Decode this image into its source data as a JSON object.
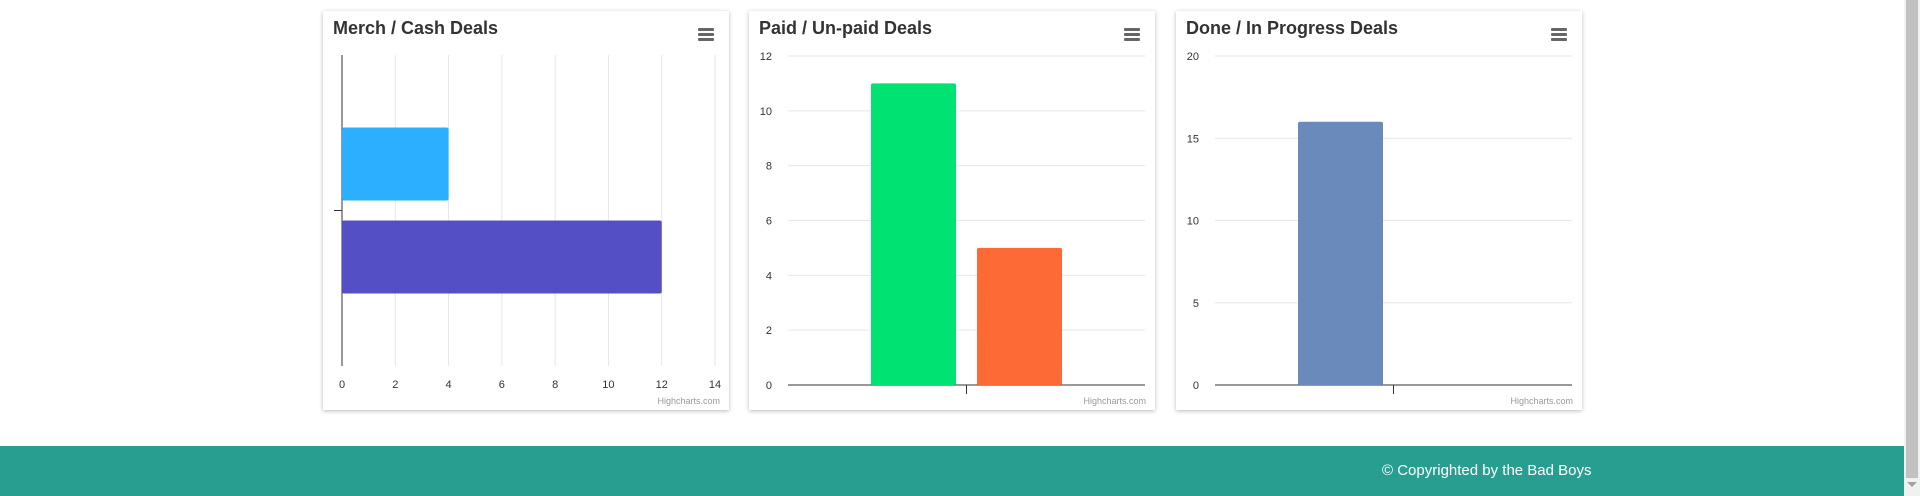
{
  "charts": [
    {
      "title": "Merch / Cash Deals",
      "menu_icon": "hamburger-menu-icon",
      "credit": "Highcharts.com",
      "chart_data": {
        "type": "bar",
        "orientation": "horizontal",
        "title": "Merch / Cash Deals",
        "xlabel": "",
        "ylabel": "",
        "categories": [
          ""
        ],
        "series": [
          {
            "values": [
              4
            ],
            "color": "#2caffe"
          },
          {
            "values": [
              12
            ],
            "color": "#544fc5"
          }
        ],
        "xlim": [
          0,
          14
        ],
        "ticks": [
          0,
          2,
          4,
          6,
          8,
          10,
          12,
          14
        ],
        "grid": true,
        "legend": "none"
      }
    },
    {
      "title": "Paid / Un-paid Deals",
      "menu_icon": "hamburger-menu-icon",
      "credit": "Highcharts.com",
      "chart_data": {
        "type": "bar",
        "orientation": "vertical",
        "title": "Paid / Un-paid Deals",
        "xlabel": "",
        "ylabel": "",
        "categories": [
          ""
        ],
        "series": [
          {
            "values": [
              11
            ],
            "color": "#00e272"
          },
          {
            "values": [
              5
            ],
            "color": "#fe6a35"
          }
        ],
        "ylim": [
          0,
          12
        ],
        "ticks": [
          0,
          2,
          4,
          6,
          8,
          10,
          12
        ],
        "grid": true,
        "legend": "none"
      }
    },
    {
      "title": "Done / In Progress Deals",
      "menu_icon": "hamburger-menu-icon",
      "credit": "Highcharts.com",
      "chart_data": {
        "type": "bar",
        "orientation": "vertical",
        "title": "Done / In Progress Deals",
        "xlabel": "",
        "ylabel": "",
        "categories": [
          ""
        ],
        "series": [
          {
            "values": [
              16
            ],
            "color": "#6b8abc"
          },
          {
            "values": [
              0
            ],
            "color": "#d568fb"
          }
        ],
        "ylim": [
          0,
          20
        ],
        "ticks": [
          0,
          5,
          10,
          15,
          20
        ],
        "grid": true,
        "legend": "none"
      }
    }
  ],
  "footer": {
    "text": "© Copyrighted by the Bad Boys",
    "color": "#289e91"
  },
  "colors": {
    "grid": "#e6e6e6",
    "axis": "#333333",
    "tick_label": "#333333"
  }
}
